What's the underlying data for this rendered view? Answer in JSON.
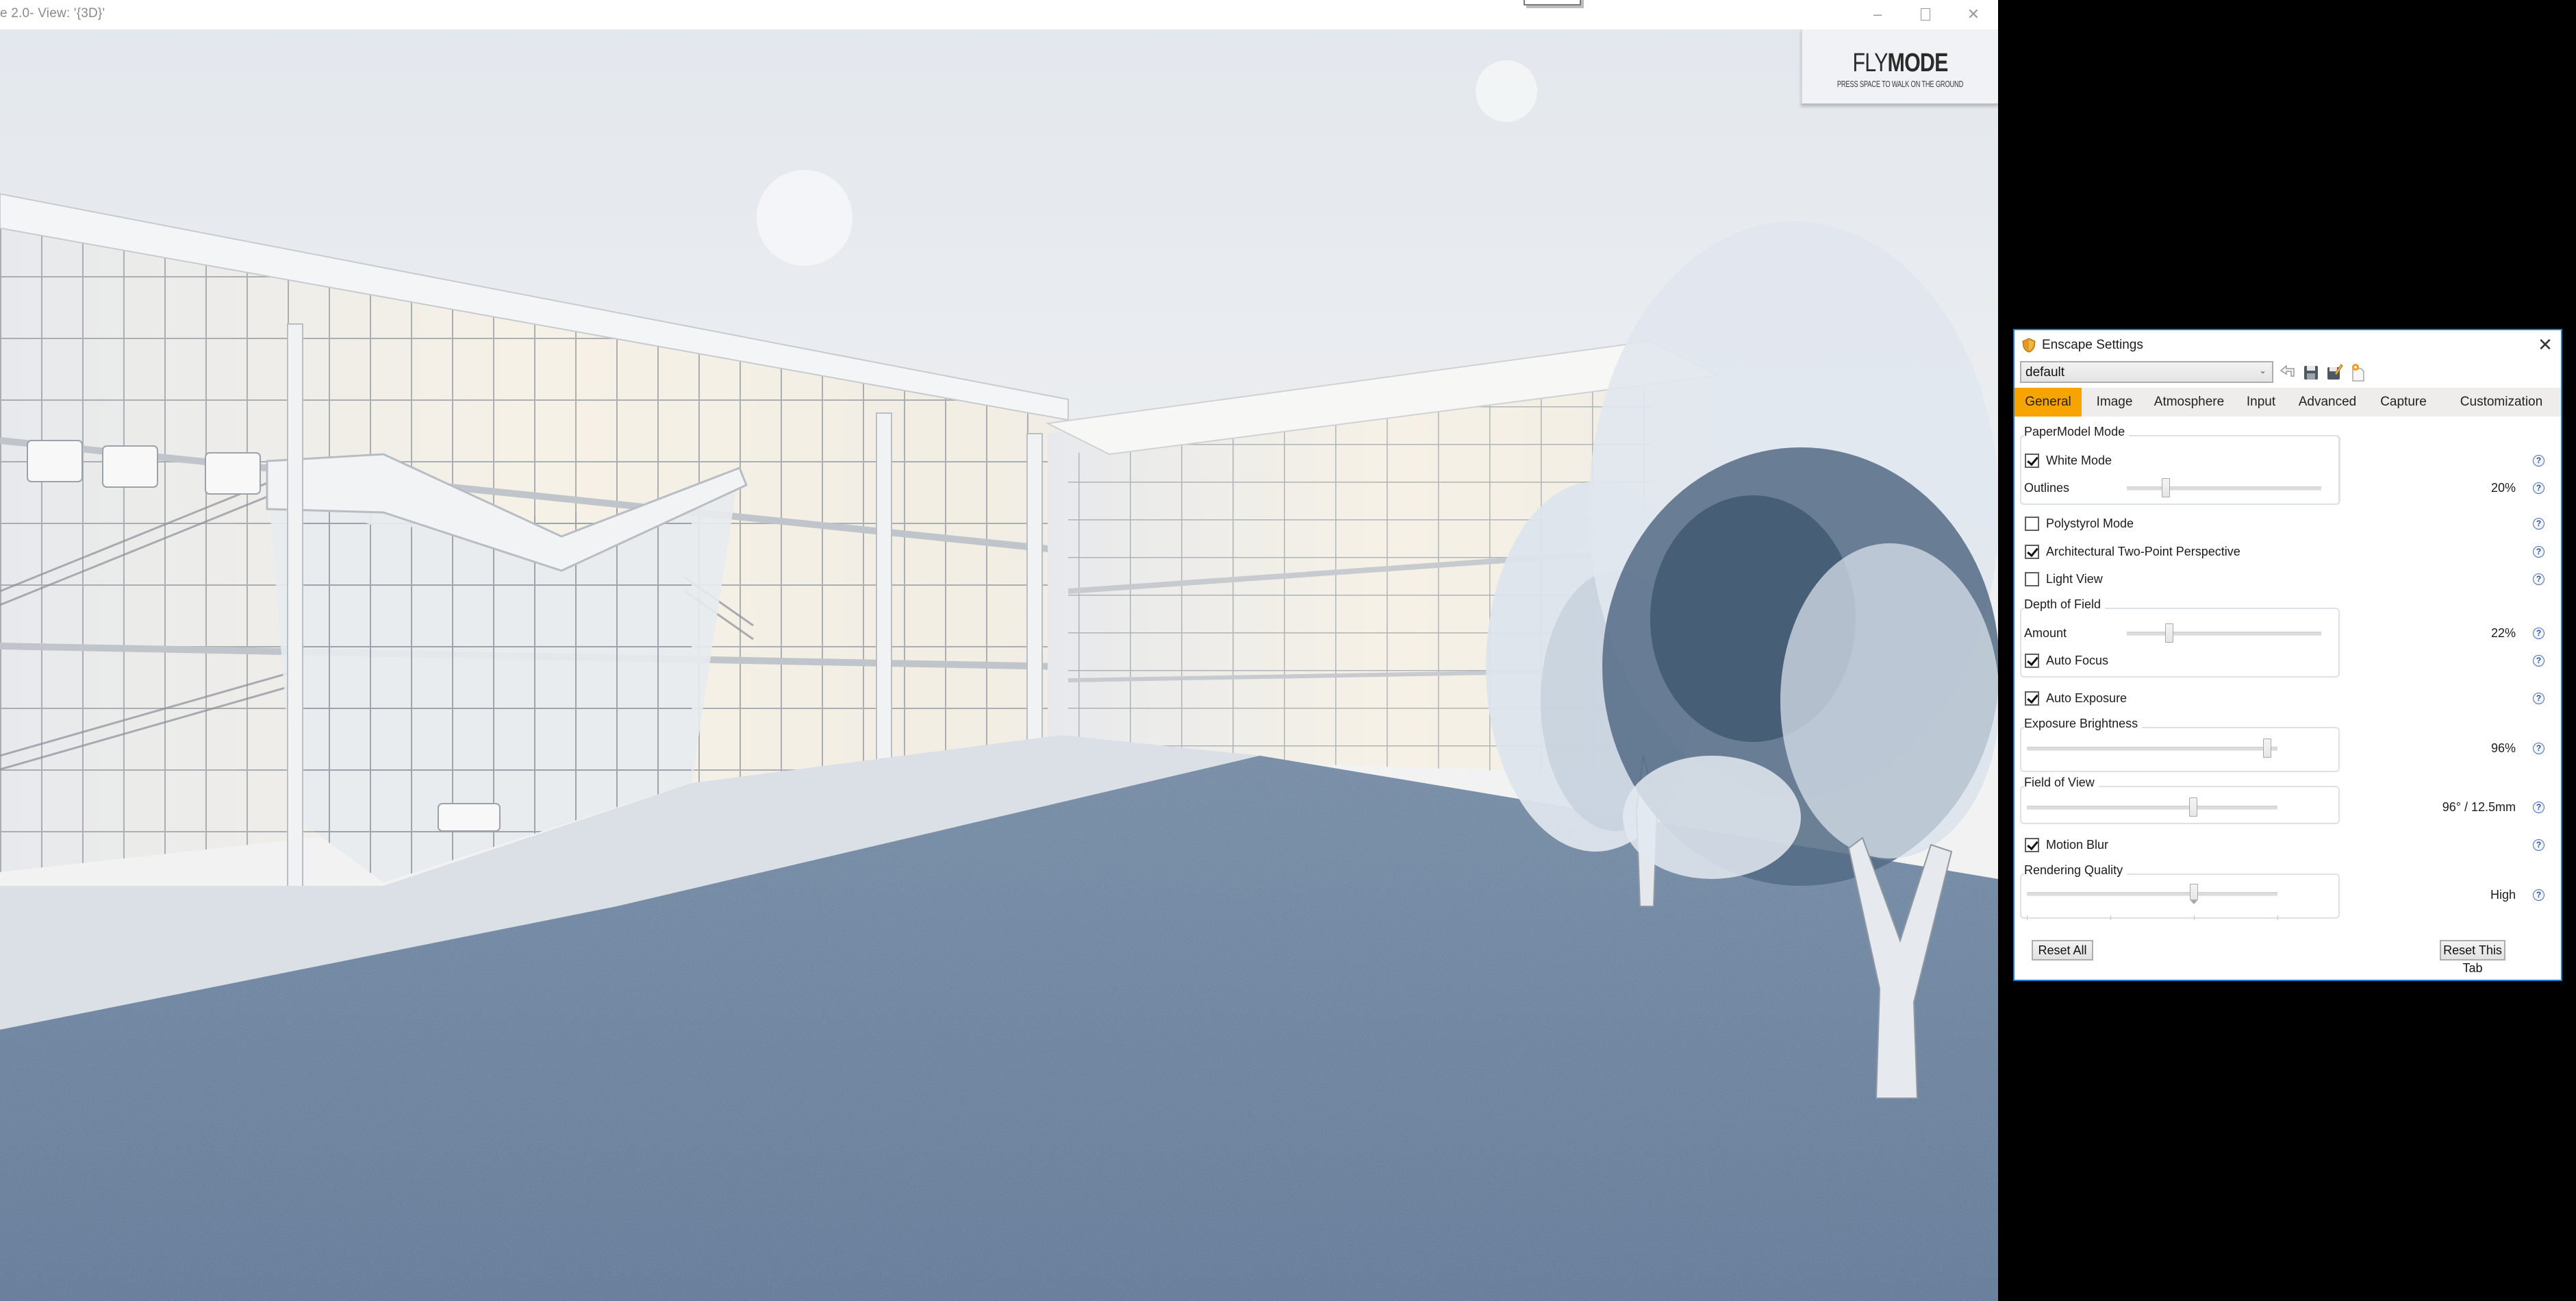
{
  "window": {
    "title": "e 2.0- View: '{3D}'",
    "controls": {
      "minimize": "–",
      "maximize": "□",
      "close": "✕"
    }
  },
  "viewport": {
    "flymode": {
      "title_light": "FLY",
      "title_bold": "MODE",
      "hint": "PRESS SPACE TO WALK ON THE GROUND"
    },
    "scene_colors": {
      "sky": "#eceff3",
      "glass": "#e9ecef",
      "ground": "#5c7592",
      "tree_dark": "#3d5570",
      "tree_light": "#dfe6ee"
    }
  },
  "dialog": {
    "title": "Enscape Settings",
    "close_icon": "✕",
    "preset": {
      "selected": "default",
      "chevron": "⌄"
    },
    "toolbar_icons": [
      "undo-icon",
      "save-icon",
      "save-as-icon",
      "new-preset-icon"
    ],
    "accent_color": "#f8a400",
    "tabs": [
      {
        "label": "General",
        "active": true
      },
      {
        "label": "Image",
        "active": false
      },
      {
        "label": "Atmosphere",
        "active": false
      },
      {
        "label": "Input",
        "active": false
      },
      {
        "label": "Advanced",
        "active": false
      },
      {
        "label": "Capture",
        "active": false
      },
      {
        "label": "Customization",
        "active": false
      }
    ],
    "general": {
      "papermodel": {
        "section": "PaperModel Mode",
        "white_mode": {
          "label": "White Mode",
          "checked": true
        },
        "outlines": {
          "label": "Outlines",
          "value_text": "20%",
          "value": 0.2
        }
      },
      "polystyrol": {
        "label": "Polystyrol Mode",
        "checked": false
      },
      "two_point": {
        "label": "Architectural Two-Point Perspective",
        "checked": true
      },
      "light_view": {
        "label": "Light View",
        "checked": false
      },
      "dof": {
        "section": "Depth of Field",
        "amount": {
          "label": "Amount",
          "value_text": "22%",
          "value": 0.22
        },
        "auto_focus": {
          "label": "Auto Focus",
          "checked": true
        }
      },
      "auto_exposure": {
        "label": "Auto Exposure",
        "checked": true
      },
      "exposure": {
        "section": "Exposure Brightness",
        "value_text": "96%",
        "value": 0.96
      },
      "fov": {
        "section": "Field of View",
        "value_text": "96° / 12.5mm",
        "value": 0.665
      },
      "motion_blur": {
        "label": "Motion Blur",
        "checked": true
      },
      "quality": {
        "section": "Rendering Quality",
        "value_text": "High",
        "level": 3,
        "levels": 4
      },
      "help_glyph": "?"
    },
    "buttons": {
      "reset_all": "Reset All",
      "reset_tab": "Reset This Tab"
    }
  }
}
